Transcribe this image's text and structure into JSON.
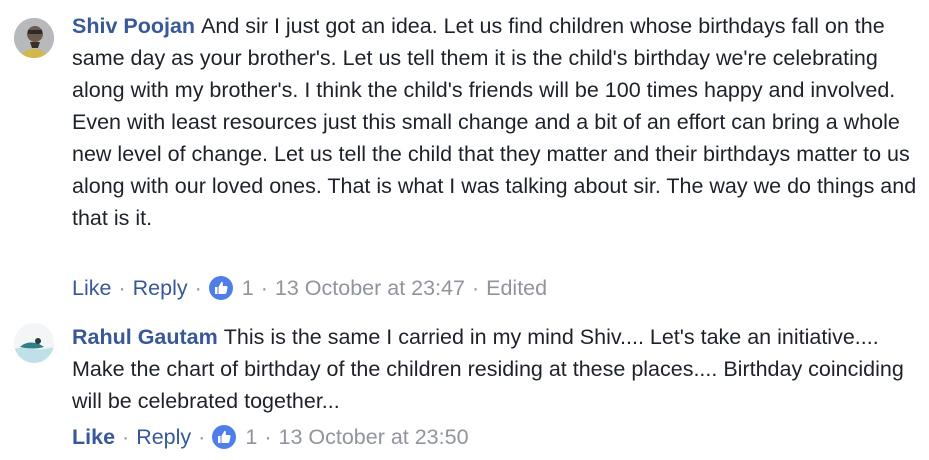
{
  "comments": [
    {
      "author": "Shiv Poojan",
      "text": "And sir I just got an idea. Let us find children whose birthdays fall on the same day as your brother's. Let us tell them it is the child's birthday we're celebrating along with my brother's. I think the child's friends will be 100 times happy and involved. Even with least resources just this small change and a bit of an effort can bring a whole new level of change. Let us tell the child that they matter and their birthdays matter to us along with our loved ones. That is what I was talking about sir. The way we do things and that is it.",
      "like_label": "Like",
      "reply_label": "Reply",
      "reactions_count": "1",
      "timestamp": "13 October at 23:47",
      "edited_label": "Edited",
      "reaction_icon": "thumbs-up-icon",
      "reaction_color": "#4f7ee8"
    },
    {
      "author": "Rahul Gautam",
      "text": "This is the same I carried in my mind Shiv.... Let's take an initiative.... Make the chart of birthday of the children residing at these places.... Birthday coinciding will be celebrated together...",
      "like_label": "Like",
      "reply_label": "Reply",
      "reactions_count": "1",
      "timestamp": "13 October at 23:50",
      "reaction_icon": "thumbs-up-icon",
      "reaction_color": "#4f7ee8"
    }
  ],
  "colors": {
    "author_link": "#385898",
    "body_text": "#1d2129",
    "meta_text": "#90949c"
  }
}
